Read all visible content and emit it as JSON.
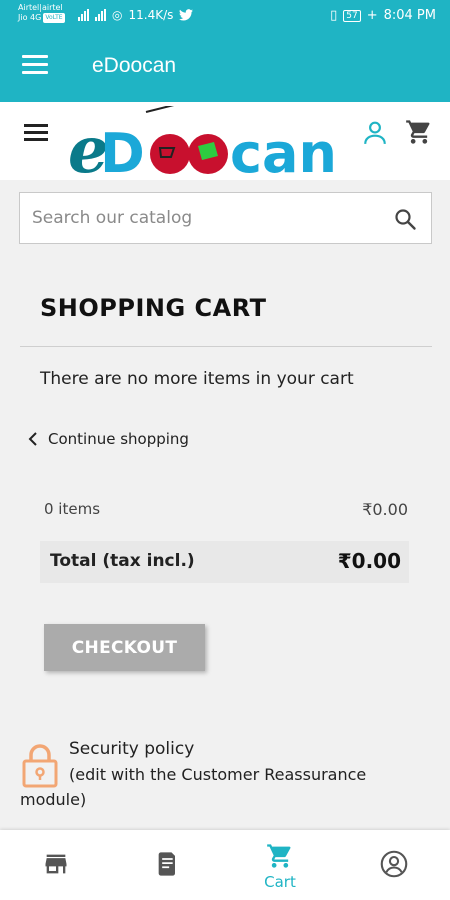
{
  "status_bar": {
    "carrier_line1": "Airtel|airtel",
    "carrier_line2": "Jio 4G",
    "volte": "VoLTE",
    "speed": "11.4K/s",
    "battery": "57",
    "time": "8:04 PM"
  },
  "app_bar": {
    "title": "eDoocan"
  },
  "logo": {
    "text_e": "e",
    "text_d": "D",
    "text_rest": "can"
  },
  "search": {
    "placeholder": "Search our catalog"
  },
  "cart": {
    "title": "SHOPPING CART",
    "empty_message": "There are no more items in your cart",
    "continue_label": "Continue shopping",
    "items_label": "0 items",
    "items_amount": "₹0.00",
    "total_label": "Total (tax incl.)",
    "total_amount": "₹0.00",
    "checkout_label": "CHECKOUT"
  },
  "reassurance": {
    "title": "Security policy",
    "line1": "(edit with the Customer Reassurance",
    "line2": "module)"
  },
  "bottom_nav": {
    "items": [
      {
        "icon": "store-icon",
        "label": ""
      },
      {
        "icon": "receipt-icon",
        "label": ""
      },
      {
        "icon": "cart-icon",
        "label": "Cart",
        "active": true
      },
      {
        "icon": "account-icon",
        "label": ""
      }
    ]
  },
  "colors": {
    "brand": "#1fb4c4",
    "checkout_disabled": "#ababab",
    "lock": "#f2a674",
    "logo_red": "#c8102e",
    "logo_green": "#2ecc40"
  }
}
